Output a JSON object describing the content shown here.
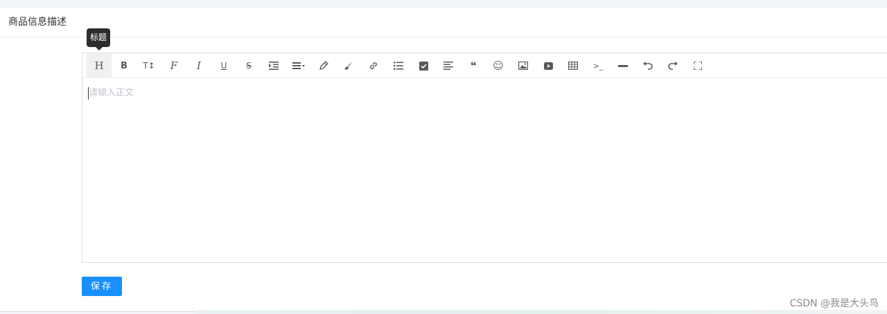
{
  "section": {
    "title": "商品信息描述"
  },
  "editor": {
    "placeholder": "请输入正文",
    "tooltip": "标题",
    "toolbar": [
      {
        "name": "heading",
        "glyph": "H"
      },
      {
        "name": "bold",
        "glyph": "B"
      },
      {
        "name": "font-size",
        "glyph": "T↕"
      },
      {
        "name": "font-family",
        "glyph": "F"
      },
      {
        "name": "italic",
        "glyph": "I"
      },
      {
        "name": "underline",
        "glyph": "U"
      },
      {
        "name": "strikethrough",
        "glyph": "S"
      },
      {
        "name": "indent",
        "glyph": ""
      },
      {
        "name": "line-height",
        "glyph": ""
      },
      {
        "name": "font-color",
        "glyph": ""
      },
      {
        "name": "background-color",
        "glyph": ""
      },
      {
        "name": "link",
        "glyph": ""
      },
      {
        "name": "list",
        "glyph": ""
      },
      {
        "name": "todo",
        "glyph": ""
      },
      {
        "name": "justify",
        "glyph": ""
      },
      {
        "name": "quote",
        "glyph": "❝"
      },
      {
        "name": "emoticon",
        "glyph": "☺"
      },
      {
        "name": "image",
        "glyph": ""
      },
      {
        "name": "video",
        "glyph": ""
      },
      {
        "name": "table",
        "glyph": ""
      },
      {
        "name": "code",
        "glyph": ">_"
      },
      {
        "name": "divider",
        "glyph": ""
      },
      {
        "name": "undo",
        "glyph": ""
      },
      {
        "name": "redo",
        "glyph": ""
      },
      {
        "name": "fullscreen",
        "glyph": ""
      }
    ]
  },
  "actions": {
    "save_label": "保存"
  },
  "watermark": "CSDN @我是大头鸟",
  "colors": {
    "primary": "#1890ff",
    "tooltip_bg": "#2d2d2d",
    "icon": "#595959",
    "placeholder": "#c0c4cc"
  }
}
